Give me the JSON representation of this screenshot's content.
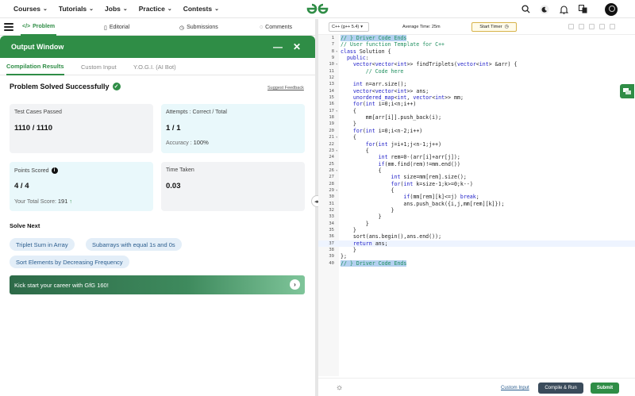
{
  "nav": {
    "menu": [
      "Courses",
      "Tutorials",
      "Jobs",
      "Practice",
      "Contests"
    ],
    "logo": "GfG"
  },
  "subtabs": [
    "Problem",
    "Editorial",
    "Submissions",
    "Comments"
  ],
  "output": {
    "title": "Output Window",
    "tabs": [
      "Compilation Results",
      "Custom Input",
      "Y.O.G.I. (AI Bot)"
    ],
    "status": "Problem Solved Successfully",
    "feedback": "Suggest Feedback",
    "cards": {
      "tests_label": "Test Cases Passed",
      "tests_value": "1110 / 1110",
      "attempts_label": "Attempts : Correct / Total",
      "attempts_value": "1 / 1",
      "accuracy_label": "Accuracy :",
      "accuracy_value": "100%",
      "points_label": "Points Scored",
      "points_value": "4 / 4",
      "total_label": "Your Total Score:",
      "total_value": "191",
      "time_label": "Time Taken",
      "time_value": "0.03"
    },
    "solve_next": "Solve Next",
    "suggestions": [
      "Triplet Sum in Array",
      "Subarrays with equal 1s and 0s",
      "Sort Elements by Decreasing Frequency"
    ],
    "banner": "Kick start your career with GfG 160!"
  },
  "editor": {
    "language": "C++ (g++ 5.4)",
    "avg_time": "Average Time: 25m",
    "timer": "Start Timer",
    "custom_input": "Custom Input",
    "compile_run": "Compile & Run",
    "submit": "Submit",
    "lines": [
      {
        "n": "1",
        "text": "// } Driver Code Ends"
      },
      {
        "n": "7",
        "text": "// User function Template for C++"
      },
      {
        "n": "8",
        "text": "class Solution {"
      },
      {
        "n": "9",
        "text": "  public:"
      },
      {
        "n": "10",
        "text": "    vector<vector<int>> findTriplets(vector<int> &arr) {"
      },
      {
        "n": "11",
        "text": "        // Code here"
      },
      {
        "n": "12",
        "text": ""
      },
      {
        "n": "13",
        "text": "    int n=arr.size();"
      },
      {
        "n": "14",
        "text": "    vector<vector<int>> ans;"
      },
      {
        "n": "15",
        "text": "    unordered_map<int, vector<int>> mm;"
      },
      {
        "n": "16",
        "text": "    for(int i=0;i<n;i++)"
      },
      {
        "n": "17",
        "text": "    {"
      },
      {
        "n": "18",
        "text": "        mm[arr[i]].push_back(i);"
      },
      {
        "n": "19",
        "text": "    }"
      },
      {
        "n": "20",
        "text": "    for(int i=0;i<n-2;i++)"
      },
      {
        "n": "21",
        "text": "    {"
      },
      {
        "n": "22",
        "text": "        for(int j=i+1;j<n-1;j++)"
      },
      {
        "n": "23",
        "text": "        {"
      },
      {
        "n": "24",
        "text": "            int rem=0-(arr[i]+arr[j]);"
      },
      {
        "n": "25",
        "text": "            if(mm.find(rem)!=mm.end())"
      },
      {
        "n": "26",
        "text": "            {"
      },
      {
        "n": "27",
        "text": "                int size=mm[rem].size();"
      },
      {
        "n": "28",
        "text": "                for(int k=size-1;k>=0;k--)"
      },
      {
        "n": "29",
        "text": "                {"
      },
      {
        "n": "30",
        "text": "                    if(mm[rem][k]<=j) break;"
      },
      {
        "n": "31",
        "text": "                    ans.push_back({i,j,mm[rem][k]});"
      },
      {
        "n": "32",
        "text": "                }"
      },
      {
        "n": "33",
        "text": "            }"
      },
      {
        "n": "34",
        "text": "        }"
      },
      {
        "n": "35",
        "text": "    }"
      },
      {
        "n": "36",
        "text": "    sort(ans.begin(),ans.end());"
      },
      {
        "n": "37",
        "text": "    return ans;"
      },
      {
        "n": "38",
        "text": "    }"
      },
      {
        "n": "39",
        "text": "};"
      },
      {
        "n": "40",
        "text": "// } Driver Code Ends"
      }
    ]
  },
  "colors": {
    "brand": "#2f8d46",
    "pill_bg": "#e3eef8",
    "card_grey": "#f2f3f5",
    "card_cyan": "#e9f8fb"
  }
}
